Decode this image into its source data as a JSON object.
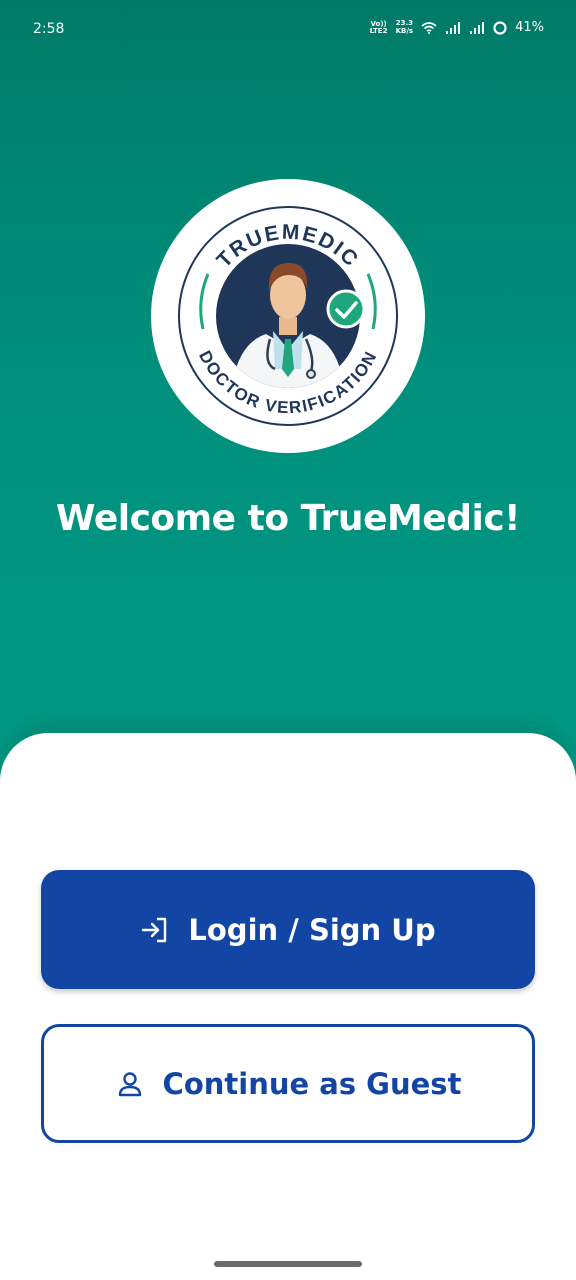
{
  "status_bar": {
    "time": "2:58",
    "volte": "Vo)) LTE2",
    "speed_value": "23.3",
    "speed_unit": "KB/s",
    "battery": "41%"
  },
  "logo": {
    "top_text": "TRUEMEDIC",
    "bottom_text": "DOCTOR VERIFICATION",
    "icon": "verified-doctor-badge"
  },
  "welcome_title": "Welcome to TrueMedic!",
  "buttons": {
    "login_label": "Login / Sign Up",
    "login_icon": "login-icon",
    "guest_label": "Continue as Guest",
    "guest_icon": "user-icon"
  },
  "colors": {
    "hero_top": "#007a68",
    "hero_bottom": "#009a85",
    "primary": "#1346a4",
    "badge_green": "#1ea67d",
    "dark_navy": "#1f3658"
  }
}
